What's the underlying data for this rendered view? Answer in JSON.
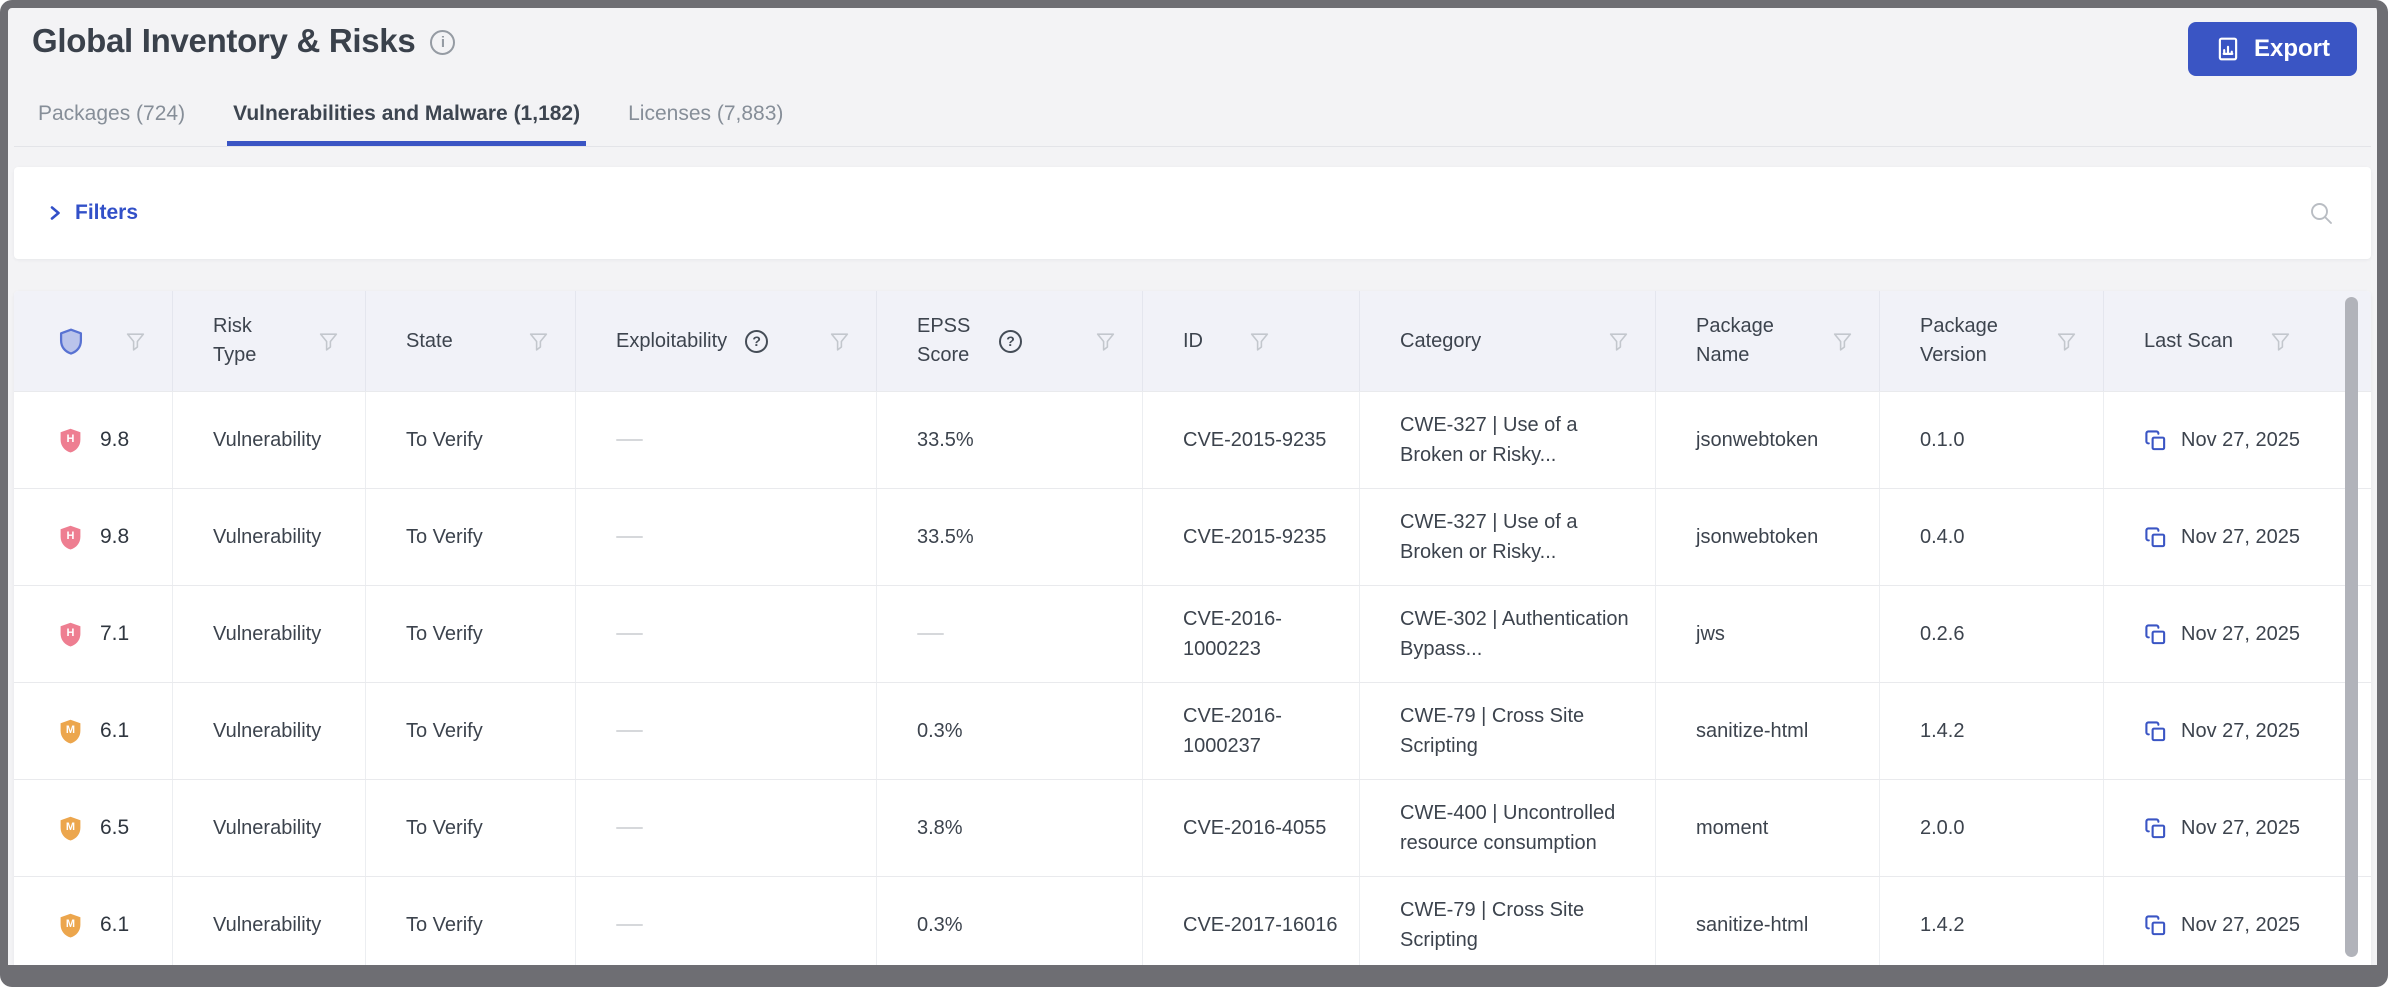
{
  "header": {
    "title": "Global Inventory & Risks",
    "export_button": "Export"
  },
  "tabs": [
    {
      "label": "Packages (724)",
      "active": false
    },
    {
      "label": "Vulnerabilities and Malware (1,182)",
      "active": true
    },
    {
      "label": "Licenses (7,883)",
      "active": false
    }
  ],
  "filters": {
    "toggle_label": "Filters"
  },
  "table": {
    "columns": [
      {
        "id": "severity",
        "label": "",
        "icon": "shield-icon",
        "has_filter": true
      },
      {
        "id": "risk_type",
        "label": "Risk Type",
        "has_filter": true
      },
      {
        "id": "state",
        "label": "State",
        "has_filter": true
      },
      {
        "id": "exploitability",
        "label": "Exploitability",
        "has_help": true,
        "has_filter": true
      },
      {
        "id": "epss_score",
        "label": "EPSS Score",
        "has_help": true,
        "has_filter": true
      },
      {
        "id": "id",
        "label": "ID",
        "has_filter": true
      },
      {
        "id": "category",
        "label": "Category",
        "has_filter": true
      },
      {
        "id": "package_name",
        "label": "Package Name",
        "has_filter": true
      },
      {
        "id": "package_version",
        "label": "Package Version",
        "has_filter": true
      },
      {
        "id": "last_scan",
        "label": "Last Scan",
        "has_filter": true
      }
    ],
    "rows": [
      {
        "severity_level": "H",
        "score": "9.8",
        "risk_type": "Vulnerability",
        "state": "To Verify",
        "exploitability": "—",
        "epss_score": "33.5%",
        "id": "CVE-2015-9235",
        "category": "CWE-327 | Use of a Broken or Risky...",
        "package_name": "jsonwebtoken",
        "package_version": "0.1.0",
        "last_scan": "Nov 27, 2025"
      },
      {
        "severity_level": "H",
        "score": "9.8",
        "risk_type": "Vulnerability",
        "state": "To Verify",
        "exploitability": "—",
        "epss_score": "33.5%",
        "id": "CVE-2015-9235",
        "category": "CWE-327 | Use of a Broken or Risky...",
        "package_name": "jsonwebtoken",
        "package_version": "0.4.0",
        "last_scan": "Nov 27, 2025"
      },
      {
        "severity_level": "H",
        "score": "7.1",
        "risk_type": "Vulnerability",
        "state": "To Verify",
        "exploitability": "—",
        "epss_score": "—",
        "id": "CVE-2016-1000223",
        "category": "CWE-302 | Authentication Bypass...",
        "package_name": "jws",
        "package_version": "0.2.6",
        "last_scan": "Nov 27, 2025"
      },
      {
        "severity_level": "M",
        "score": "6.1",
        "risk_type": "Vulnerability",
        "state": "To Verify",
        "exploitability": "—",
        "epss_score": "0.3%",
        "id": "CVE-2016-1000237",
        "category": "CWE-79 | Cross Site Scripting",
        "package_name": "sanitize-html",
        "package_version": "1.4.2",
        "last_scan": "Nov 27, 2025"
      },
      {
        "severity_level": "M",
        "score": "6.5",
        "risk_type": "Vulnerability",
        "state": "To Verify",
        "exploitability": "—",
        "epss_score": "3.8%",
        "id": "CVE-2016-4055",
        "category": "CWE-400 | Uncontrolled resource consumption",
        "package_name": "moment",
        "package_version": "2.0.0",
        "last_scan": "Nov 27, 2025"
      },
      {
        "severity_level": "M",
        "score": "6.1",
        "risk_type": "Vulnerability",
        "state": "To Verify",
        "exploitability": "—",
        "epss_score": "0.3%",
        "id": "CVE-2017-16016",
        "category": "CWE-79 | Cross Site Scripting",
        "package_name": "sanitize-html",
        "package_version": "1.4.2",
        "last_scan": "Nov 27, 2025"
      }
    ]
  },
  "theme": {
    "accent_blue": "#3a55c4",
    "severity_high": "#ee7e91",
    "severity_medium": "#eca64d",
    "table_header_bg": "#f1f2f8",
    "page_bg": "#f3f3f5"
  }
}
